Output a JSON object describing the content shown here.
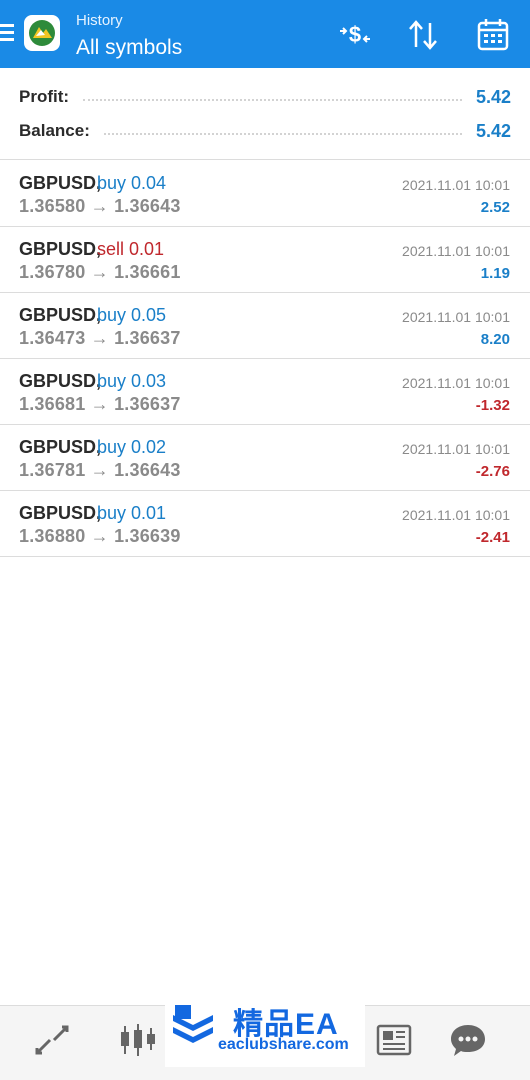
{
  "header": {
    "subtitle": "History",
    "title": "All symbols",
    "background_color": "#1a8ae6",
    "icons": [
      "menu-icon",
      "metatrader-logo-icon",
      "currency-toggle-icon",
      "sort-icon",
      "calendar-icon"
    ]
  },
  "summary": {
    "profit_label": "Profit:",
    "profit_value": "5.42",
    "balance_label": "Balance:",
    "balance_value": "5.42"
  },
  "trades": [
    {
      "symbol": "GBPUSD,",
      "side": "buy 0.04",
      "prices": "1.36580 → 1.36643",
      "time": "2021.11.01 10:01",
      "profit": "2.52"
    },
    {
      "symbol": "GBPUSD,",
      "side": "sell 0.01",
      "prices": "1.36780 → 1.36661",
      "time": "2021.11.01 10:01",
      "profit": "1.19"
    },
    {
      "symbol": "GBPUSD,",
      "side": "buy 0.05",
      "prices": "1.36473 → 1.36637",
      "time": "2021.11.01 10:01",
      "profit": "8.20"
    },
    {
      "symbol": "GBPUSD,",
      "side": "buy 0.03",
      "prices": "1.36681 → 1.36637",
      "time": "2021.11.01 10:01",
      "profit": "-1.32"
    },
    {
      "symbol": "GBPUSD,",
      "side": "buy 0.02",
      "prices": "1.36781 → 1.36643",
      "time": "2021.11.01 10:01",
      "profit": "-2.76"
    },
    {
      "symbol": "GBPUSD,",
      "side": "buy 0.01",
      "prices": "1.36880 → 1.36639",
      "time": "2021.11.01 10:01",
      "profit": "-2.41"
    }
  ],
  "colors": {
    "buy": "#1a7fc8",
    "sell": "#c0282d",
    "profit_positive": "#1a7fc8",
    "profit_negative": "#c0282d"
  },
  "bottom_nav": {
    "icons": [
      "quotes-icon",
      "chart-icon",
      "news-icon",
      "chat-icon"
    ]
  },
  "watermark": {
    "name": "精品EA",
    "url": "eaclubshare.com"
  }
}
